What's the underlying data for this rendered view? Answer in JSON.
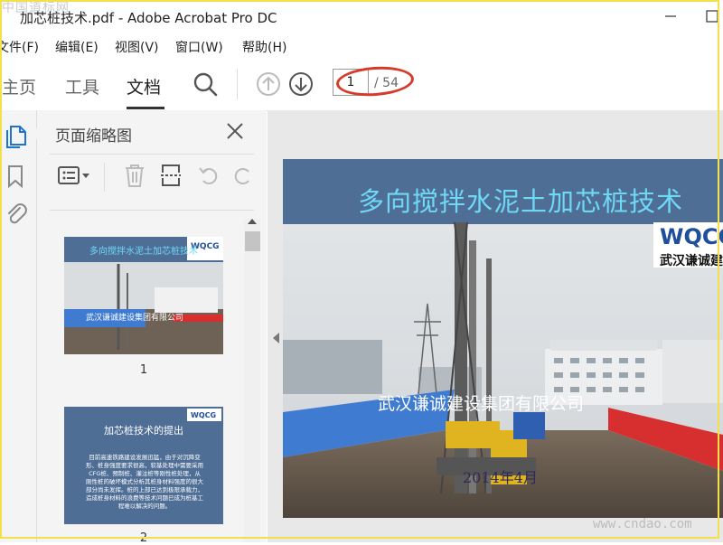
{
  "window": {
    "title": "加芯桩技术.pdf - Adobe Acrobat Pro DC",
    "watermark": "中国道标网"
  },
  "menu": [
    "文件(F)",
    "编辑(E)",
    "视图(V)",
    "窗口(W)",
    "帮助(H)"
  ],
  "toolbar": {
    "tabs": [
      "主页",
      "工具",
      "文档"
    ],
    "active_tab": "文档",
    "page_current": "1",
    "page_total": "/ 54"
  },
  "panel": {
    "title": "页面缩略图",
    "thumbnails": [
      {
        "label": "1",
        "slide_title": "多向搅拌水泥土加芯桩技术",
        "company": "武汉谦诚建设集团有限公司"
      },
      {
        "label": "2",
        "slide_title": "加芯桩技术的提出",
        "body": "目前高速铁路建设发展迅猛，由于对沉降变形、桩身强度要求很高，软基处理中需要采用CFG桩、预制桩、灌注桩等刚性桩处理，从刚性桩的破坏模式分析其桩身材料强度的很大部分尚未发挥。桩的上部已达到极限承载力，造成桩身材料的浪费等技术问题已成为桩基工程难以解决的问题。"
      }
    ]
  },
  "slide": {
    "title": "多向搅拌水泥土加芯桩技术",
    "logo": "WQCG",
    "logo_sub": "武汉谦诚建",
    "company": "武汉谦诚建设集团有限公司",
    "date": "2014年4月"
  },
  "site_watermark": "www.cndao.com",
  "colors": {
    "accent_oval": "#d63a2a",
    "slide_header": "#4f6e96",
    "slide_title": "#6fd8f5"
  }
}
